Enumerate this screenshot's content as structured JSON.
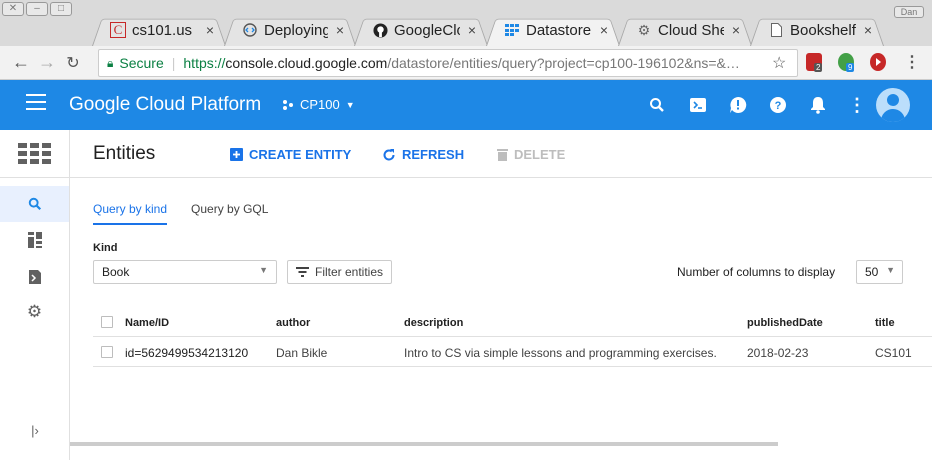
{
  "browser": {
    "tabs": [
      {
        "label": "cs101.us",
        "icon": "c-favicon-icon"
      },
      {
        "label": "Deploying",
        "icon": "code-favicon-icon"
      },
      {
        "label": "GoogleClo",
        "icon": "github-icon"
      },
      {
        "label": "Datastore",
        "icon": "datastore-favicon-icon"
      },
      {
        "label": "Cloud She",
        "icon": "gear-favicon-icon"
      },
      {
        "label": "Bookshelf",
        "icon": "page-icon"
      }
    ],
    "close_glyph": "×",
    "secure_label": "Secure",
    "url_protocol": "https://",
    "url_host": "console.cloud.google.com",
    "url_path": "/datastore/entities/query?project=cp100-196102&ns=&…",
    "ext_badges": [
      "2",
      "9"
    ],
    "window_right_label": "Dan"
  },
  "header": {
    "title": "Google Cloud Platform",
    "project": "CP100",
    "accent": "#1e88e5"
  },
  "page": {
    "title": "Entities",
    "actions": {
      "create": "CREATE ENTITY",
      "refresh": "REFRESH",
      "delete": "DELETE"
    }
  },
  "query": {
    "tabs": [
      "Query by kind",
      "Query by GQL"
    ],
    "kind_label": "Kind",
    "kind_value": "Book",
    "filter_label": "Filter entities",
    "columns_label": "Number of columns to display",
    "columns_value": "50"
  },
  "table": {
    "headers": [
      "Name/ID",
      "author",
      "description",
      "publishedDate",
      "title"
    ],
    "rows": [
      [
        "id=5629499534213120",
        "Dan Bikle",
        "Intro to CS via simple lessons and programming exercises.",
        "2018-02-23",
        "CS101"
      ]
    ]
  }
}
